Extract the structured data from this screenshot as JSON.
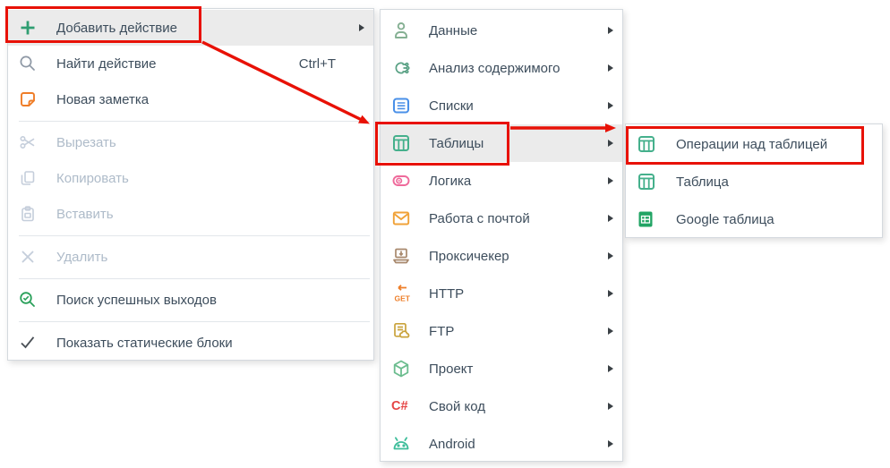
{
  "colors": {
    "red_accent": "#e81106"
  },
  "palette": {
    "green": "#2f9e72",
    "gray": "#8e98a5",
    "orange_note": "#ef7d28",
    "disabled": "#c5cedb",
    "success_green": "#2aa05a",
    "dark_check": "#4b5157",
    "sage": "#85b093",
    "analysis_green": "#57a083",
    "blue": "#4a90e8",
    "table_green": "#45b08c",
    "pink": "#ef6a9b",
    "mail_amber": "#f0a238",
    "brown": "#a8896d",
    "http_orange": "#ee7f2a",
    "ftp_gold": "#c9a33c",
    "project_green": "#6cbd8f",
    "csharp_red": "#e54545",
    "android_teal": "#3dbd9a",
    "sheets_green": "#21a464"
  },
  "left_menu": {
    "items": [
      {
        "id": "add-action",
        "label": "Добавить действие",
        "icon": "plus-icon",
        "submenu": true,
        "highlighted": true
      },
      {
        "id": "find-action",
        "label": "Найти действие",
        "icon": "search-icon",
        "shortcut": "Ctrl+T"
      },
      {
        "id": "new-note",
        "label": "Новая заметка",
        "icon": "note-icon",
        "sep_after": true
      },
      {
        "id": "cut",
        "label": "Вырезать",
        "icon": "cut-icon",
        "disabled": true
      },
      {
        "id": "copy",
        "label": "Копировать",
        "icon": "copy-icon",
        "disabled": true
      },
      {
        "id": "paste",
        "label": "Вставить",
        "icon": "paste-icon",
        "disabled": true,
        "sep_after": true
      },
      {
        "id": "delete",
        "label": "Удалить",
        "icon": "delete-icon",
        "disabled": true,
        "sep_after": true
      },
      {
        "id": "search-successful-exits",
        "label": "Поиск успешных выходов",
        "icon": "search-success-icon",
        "sep_after": true
      },
      {
        "id": "show-static-blocks",
        "label": "Показать статические блоки",
        "icon": "check-icon"
      }
    ]
  },
  "middle_menu": {
    "items": [
      {
        "id": "data",
        "label": "Данные",
        "icon": "user-icon",
        "submenu": true
      },
      {
        "id": "content-analysis",
        "label": "Анализ содержимого",
        "icon": "analysis-icon",
        "submenu": true
      },
      {
        "id": "lists",
        "label": "Списки",
        "icon": "list-icon",
        "submenu": true
      },
      {
        "id": "tables",
        "label": "Таблицы",
        "icon": "table-icon",
        "submenu": true,
        "highlighted": true
      },
      {
        "id": "logic",
        "label": "Логика",
        "icon": "logic-icon",
        "submenu": true
      },
      {
        "id": "mail",
        "label": "Работа с почтой",
        "icon": "mail-icon",
        "submenu": true
      },
      {
        "id": "proxychecker",
        "label": "Проксичекер",
        "icon": "proxy-icon",
        "submenu": true
      },
      {
        "id": "http",
        "label": "HTTP",
        "icon": "http-get-icon",
        "submenu": true
      },
      {
        "id": "ftp",
        "label": "FTP",
        "icon": "ftp-icon",
        "submenu": true
      },
      {
        "id": "project",
        "label": "Проект",
        "icon": "project-icon",
        "submenu": true
      },
      {
        "id": "own-code",
        "label": "Свой код",
        "icon": "csharp-icon",
        "submenu": true
      },
      {
        "id": "android",
        "label": "Android",
        "icon": "android-icon",
        "submenu": true
      }
    ]
  },
  "right_menu": {
    "items": [
      {
        "id": "table-operations",
        "label": "Операции над таблицей",
        "icon": "table-icon",
        "boxed": true
      },
      {
        "id": "table",
        "label": "Таблица",
        "icon": "table-icon"
      },
      {
        "id": "google-table",
        "label": "Google таблица",
        "icon": "google-sheet-icon"
      }
    ]
  }
}
